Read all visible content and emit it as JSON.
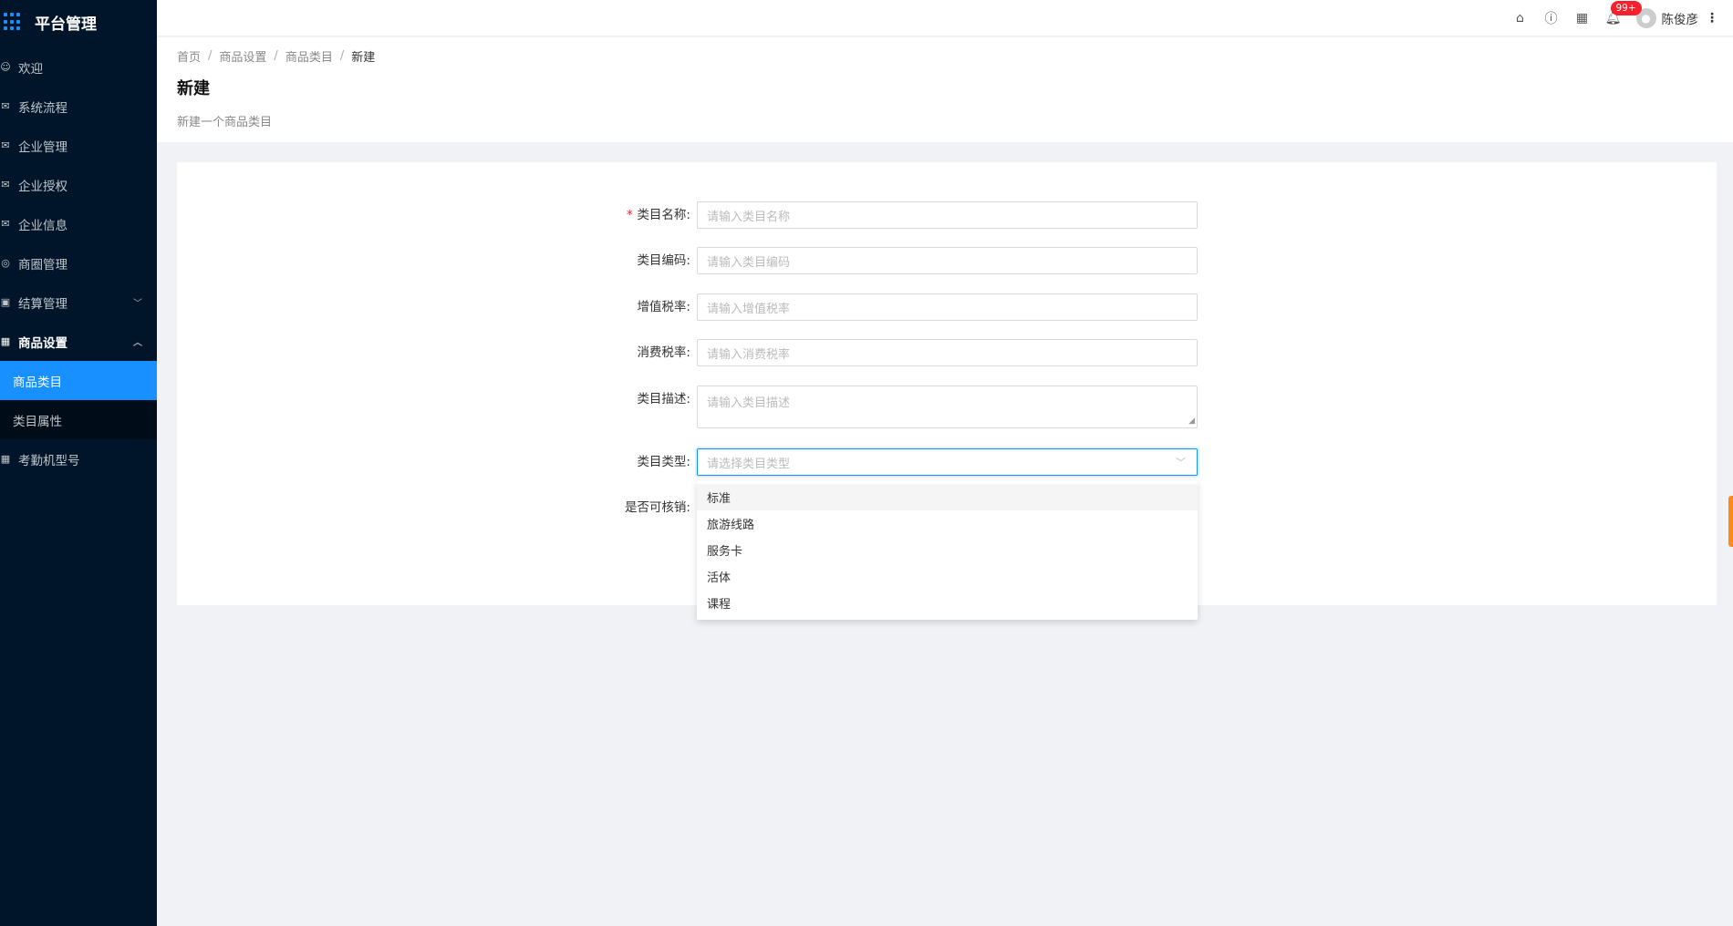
{
  "app": {
    "title": "平台管理"
  },
  "sidebar": {
    "items": [
      {
        "label": "欢迎",
        "icon": "smile-icon"
      },
      {
        "label": "系统流程",
        "icon": "mail-icon"
      },
      {
        "label": "企业管理",
        "icon": "mail-icon"
      },
      {
        "label": "企业授权",
        "icon": "mail-icon"
      },
      {
        "label": "企业信息",
        "icon": "mail-icon"
      },
      {
        "label": "商圈管理",
        "icon": "compass-icon"
      },
      {
        "label": "结算管理",
        "icon": "calculator-icon"
      },
      {
        "label": "商品设置",
        "icon": "appstore-icon"
      },
      {
        "label": "考勤机型号",
        "icon": "appstore-icon"
      }
    ],
    "submenu": [
      {
        "label": "商品类目",
        "active": true
      },
      {
        "label": "类目属性",
        "active": false
      }
    ]
  },
  "header": {
    "notification_count": "99+",
    "user_name": "陈俊彦"
  },
  "breadcrumb": [
    "首页",
    "商品设置",
    "商品类目",
    "新建"
  ],
  "page": {
    "title": "新建",
    "description": "新建一个商品类目"
  },
  "form": {
    "fields": [
      {
        "label": "类目名称:",
        "placeholder": "请输入类目名称",
        "required": true
      },
      {
        "label": "类目编码:",
        "placeholder": "请输入类目编码",
        "required": false
      },
      {
        "label": "增值税率:",
        "placeholder": "请输入增值税率",
        "required": false
      },
      {
        "label": "消费税率:",
        "placeholder": "请输入消费税率",
        "required": false
      },
      {
        "label": "类目描述:",
        "placeholder": "请输入类目描述",
        "required": false
      },
      {
        "label": "类目类型:",
        "placeholder": "请选择类目类型",
        "required": false
      },
      {
        "label": "是否可核销:",
        "placeholder": "",
        "required": false
      }
    ],
    "type_options": [
      "标准",
      "旅游线路",
      "服务卡",
      "活体",
      "课程"
    ]
  },
  "colors": {
    "sidebar_bg": "#001529",
    "primary": "#1890ff",
    "badge": "#f5222d"
  }
}
